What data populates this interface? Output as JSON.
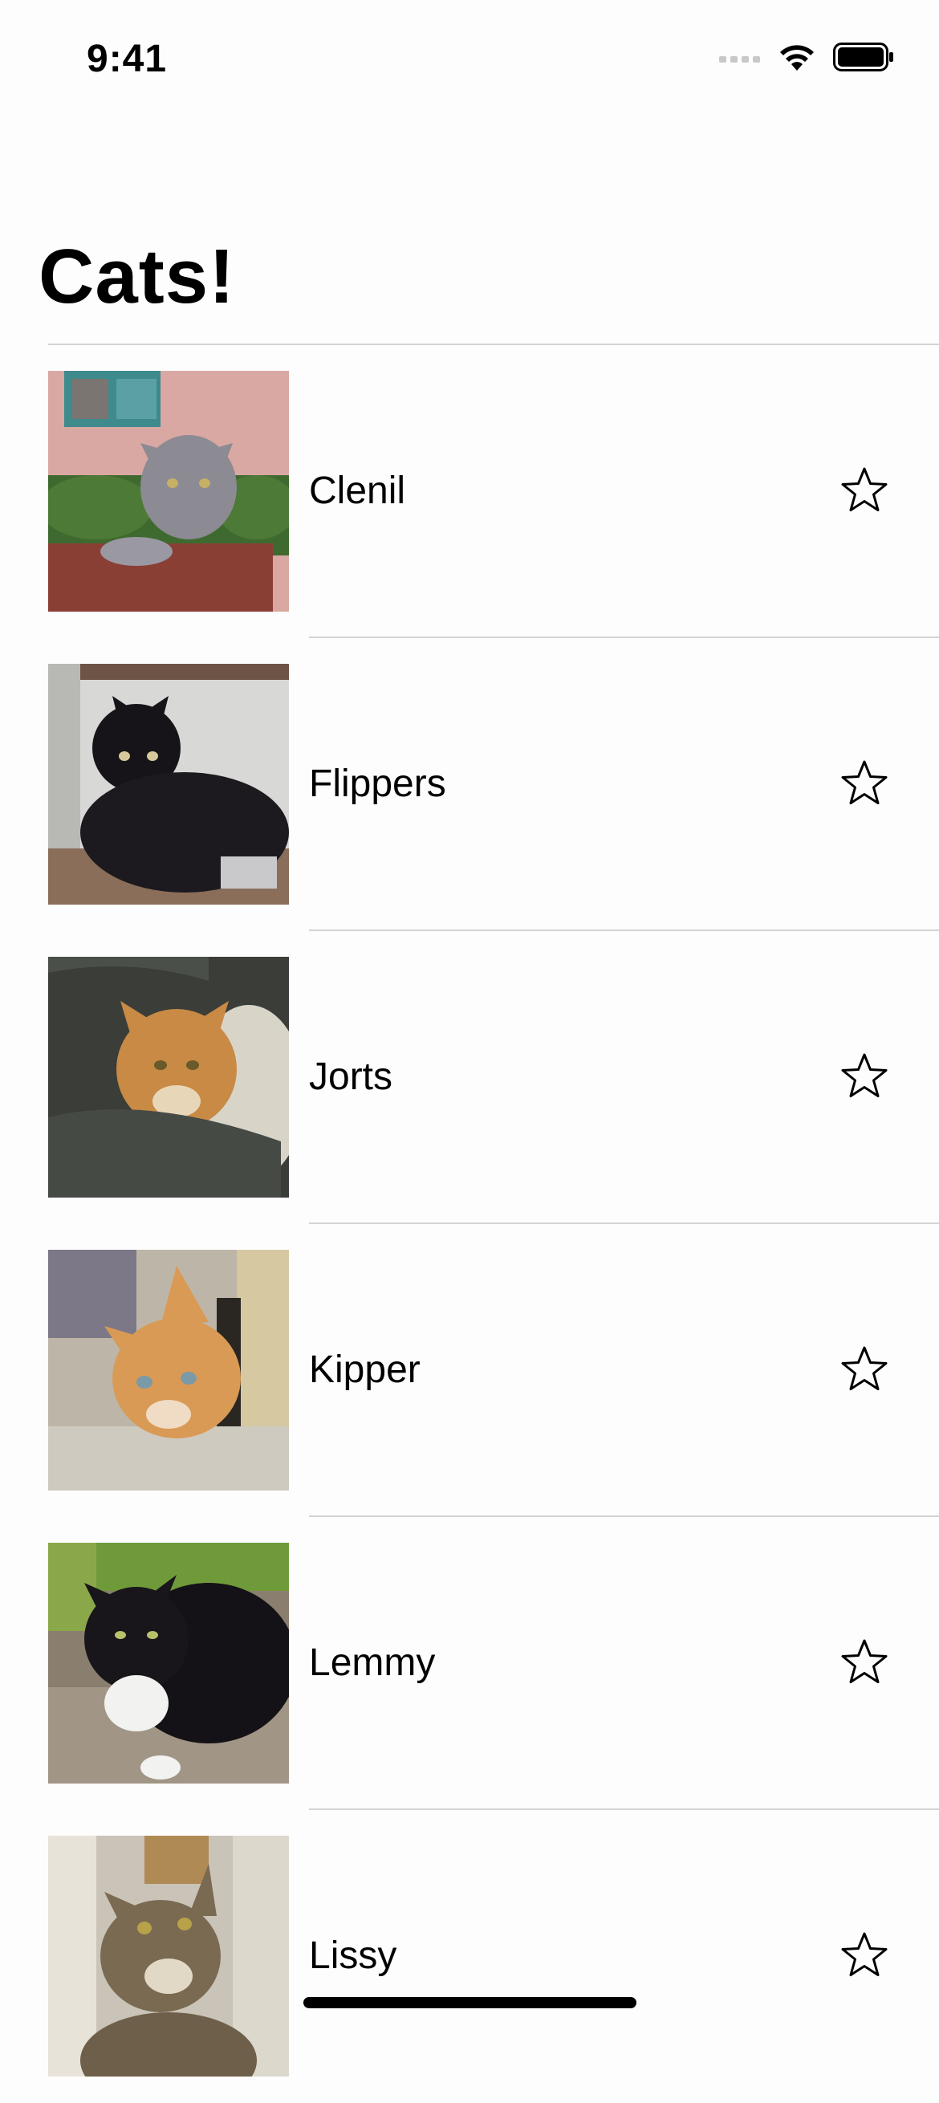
{
  "status_bar": {
    "time": "9:41",
    "icons": [
      "cellular-signal-icon",
      "wifi-icon",
      "battery-icon"
    ]
  },
  "nav": {
    "title": "Cats!"
  },
  "cats": [
    {
      "name": "Clenil",
      "favorite": false,
      "photo": "grey-tabby-cat-photo"
    },
    {
      "name": "Flippers",
      "favorite": false,
      "photo": "black-cat-photo"
    },
    {
      "name": "Jorts",
      "favorite": false,
      "photo": "orange-cat-in-blanket-photo"
    },
    {
      "name": "Kipper",
      "favorite": false,
      "photo": "orange-kitten-photo"
    },
    {
      "name": "Lemmy",
      "favorite": false,
      "photo": "tuxedo-cat-photo"
    },
    {
      "name": "Lissy",
      "favorite": false,
      "photo": "tabby-cat-photo"
    }
  ],
  "colors": {
    "background": "#fdfdfd",
    "text": "#000000",
    "divider": "#d4d4d4"
  }
}
